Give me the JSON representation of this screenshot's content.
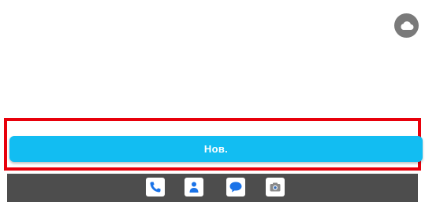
{
  "top_right": {
    "icon": "cloud-icon"
  },
  "main": {
    "new_button_label": "Нов."
  },
  "taskbar": {
    "apps": [
      {
        "name": "phone-icon"
      },
      {
        "name": "contacts-icon"
      },
      {
        "name": "messages-icon"
      },
      {
        "name": "camera-icon"
      }
    ]
  },
  "colors": {
    "button": "#12bdf2",
    "highlight": "#e8000b",
    "taskbar": "#4d4d4d",
    "app_icon_blue": "#1a73e8"
  }
}
